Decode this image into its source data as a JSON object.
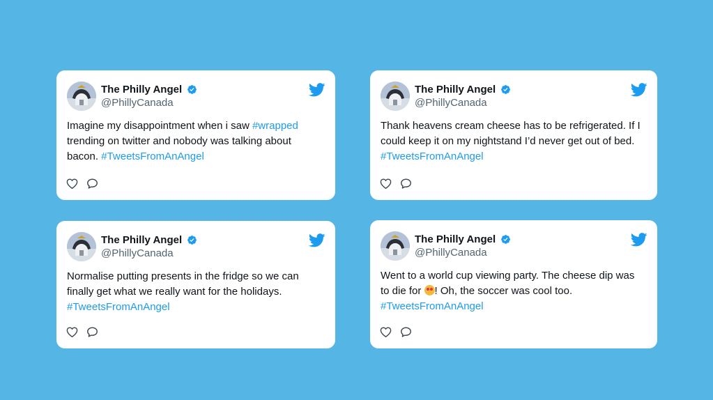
{
  "colors": {
    "background": "#55b5e5",
    "card": "#ffffff",
    "hashtag": "#1d9bf0",
    "verified": "#1d9bf0",
    "bird": "#1d9bf0"
  },
  "icons": {
    "verified": "verified-badge-icon",
    "bird": "twitter-bird-icon",
    "like": "heart-icon",
    "reply": "speech-bubble-icon",
    "emoji": "heart-eyes-emoji"
  },
  "tweets": [
    {
      "name": "The Philly Angel",
      "handle": "@PhillyCanada",
      "text_a": "Imagine my disappointment when i saw ",
      "tag_a": "#wrapped",
      "text_b": " trending on twitter and nobody was talking about bacon. ",
      "tag_b": "#TweetsFromAnAngel"
    },
    {
      "name": "The Philly Angel",
      "handle": "@PhillyCanada",
      "text_a": "Thank heavens cream cheese has to be refrigerated. If I could keep it on my nightstand I’d never get out of bed. ",
      "tag_a": "#TweetsFromAnAngel"
    },
    {
      "name": "The Philly Angel",
      "handle": "@PhillyCanada",
      "text_a": "Normalise putting presents in the fridge so we can finally get what we really want for the holidays. ",
      "tag_a": "#TweetsFromAnAngel"
    },
    {
      "name": "The Philly Angel",
      "handle": "@PhillyCanada",
      "text_a": "Went to a world cup viewing party. The cheese dip was to die for ",
      "text_b": "! Oh, the soccer was cool too. ",
      "tag_a": "#TweetsFromAnAngel"
    }
  ]
}
